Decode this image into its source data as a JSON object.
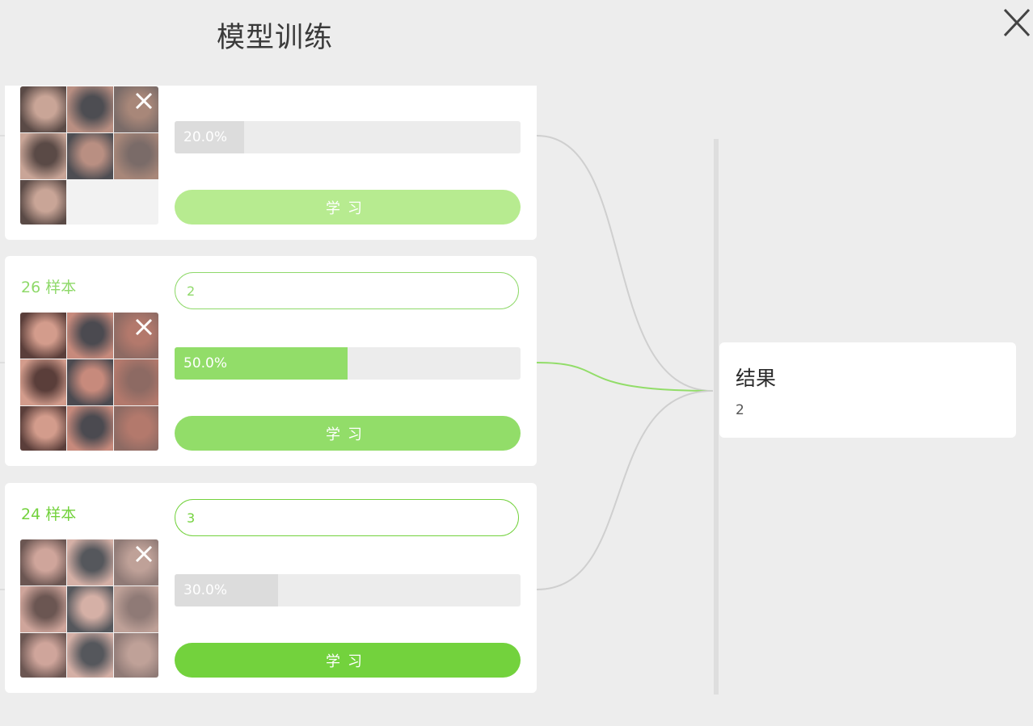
{
  "header": {
    "title": "模型训练",
    "close_icon": "close-icon"
  },
  "classes": [
    {
      "count_label": "",
      "label_value": "",
      "progress": 0.2,
      "progress_label": "20.0%",
      "learn_label": "学习",
      "colors": {
        "fill": "#dcdcdc",
        "button": "#b7eb90",
        "accent": "#8fd96a"
      },
      "thumbnail_count": 7,
      "thumbnail_tone": "fist",
      "delete_icon": "close-icon",
      "link_color": "#cfcfcf"
    },
    {
      "count_label": "26 样本",
      "label_value": "2",
      "progress": 0.5,
      "progress_label": "50.0%",
      "learn_label": "学习",
      "colors": {
        "fill": "#92dd69",
        "button": "#92dd69",
        "accent": "#8fd96a"
      },
      "thumbnail_count": 9,
      "thumbnail_tone": "peace",
      "delete_icon": "close-icon",
      "link_color": "#92dd69"
    },
    {
      "count_label": "24 样本",
      "label_value": "3",
      "progress": 0.3,
      "progress_label": "30.0%",
      "learn_label": "学习",
      "colors": {
        "fill": "#dcdcdc",
        "button": "#73d23d",
        "accent": "#73d23d"
      },
      "thumbnail_count": 9,
      "thumbnail_tone": "palm",
      "delete_icon": "close-icon",
      "link_color": "#cfcfcf"
    }
  ],
  "result": {
    "title": "结果",
    "value": "2"
  }
}
